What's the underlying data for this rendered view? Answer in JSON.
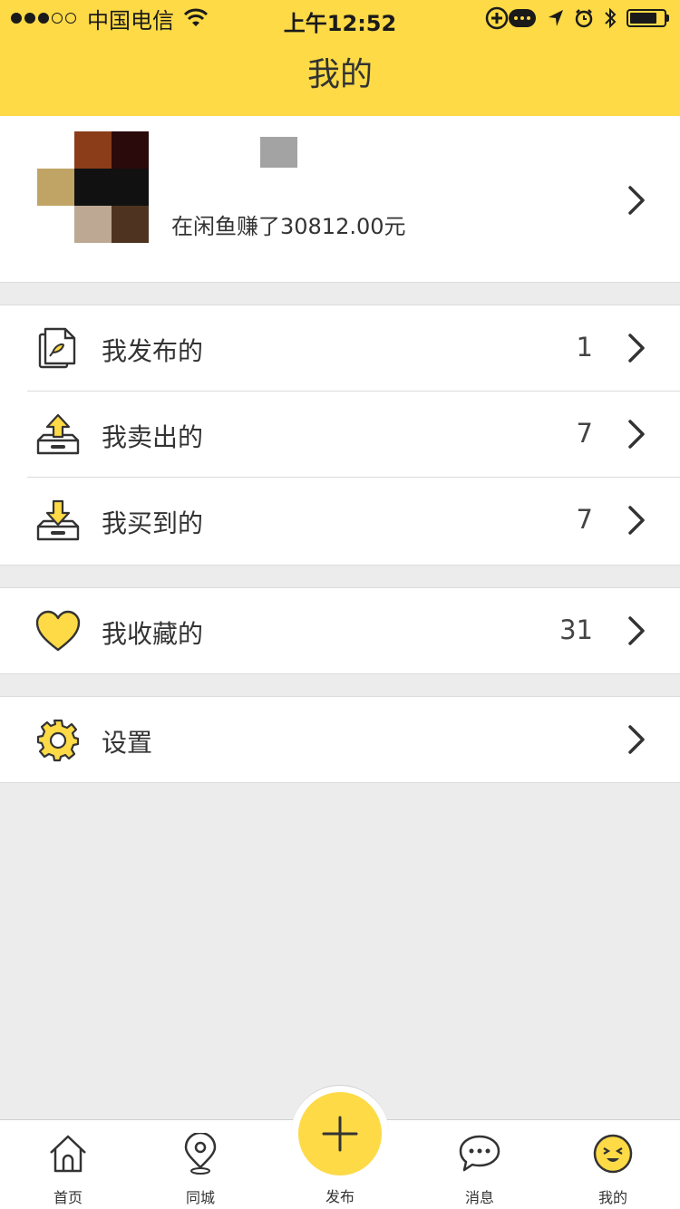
{
  "status_bar": {
    "carrier": "中国电信",
    "time": "上午12:52",
    "battery_level": 0.8
  },
  "nav": {
    "title": "我的"
  },
  "profile": {
    "earnings_text": "在闲鱼赚了30812.00元",
    "avatar_pixels": [
      "#ffffff",
      "#8a3d18",
      "#2b0a0b",
      "#c0a465",
      "#111111",
      "#111111",
      "#ffffff",
      "#bda893",
      "#4e3420"
    ]
  },
  "menu": {
    "published": {
      "label": "我发布的",
      "count": "1",
      "icon": "document-icon"
    },
    "sold": {
      "label": "我卖出的",
      "count": "7",
      "icon": "upload-tray-icon"
    },
    "bought": {
      "label": "我买到的",
      "count": "7",
      "icon": "download-tray-icon"
    },
    "favorites": {
      "label": "我收藏的",
      "count": "31",
      "icon": "heart-icon"
    },
    "settings": {
      "label": "设置",
      "icon": "gear-icon"
    }
  },
  "tabbar": {
    "home": "首页",
    "nearby": "同城",
    "publish": "发布",
    "messages": "消息",
    "mine": "我的"
  },
  "colors": {
    "accent": "#fdda46",
    "background": "#ececec",
    "text": "#333333"
  }
}
